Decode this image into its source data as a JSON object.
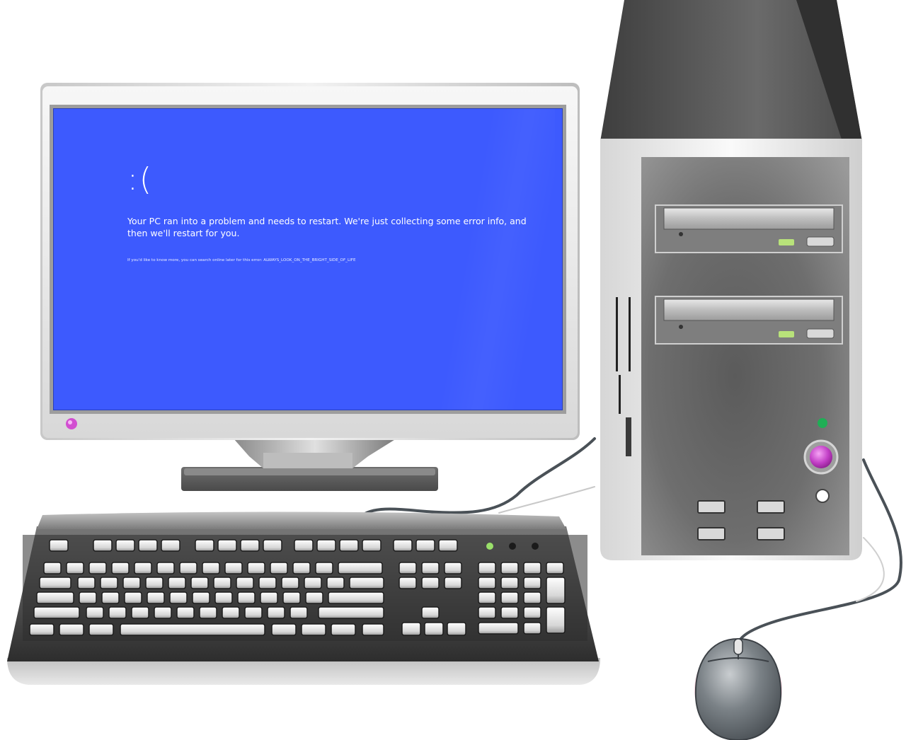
{
  "screen": {
    "sad_face": ":(",
    "message": "Your PC ran into a problem and needs to restart. We're just collecting some error info, and then we'll restart for you.",
    "stop_code_line": "If you'd like to know more, you can search online later for this error: ALWAYS_LOOK_ON_THE_BRIGHT_SIDE_OF_LIFE",
    "background_color": "#3d5afe",
    "text_color": "#ffffff"
  },
  "monitor": {
    "power_led_color": "#d24fd1"
  },
  "tower": {
    "power_button_color": "#c23fc6",
    "status_led_color": "#1fae55",
    "drive_led_color": "#b8e27a"
  },
  "icons": {
    "monitor": "monitor-icon",
    "tower": "computer-tower-icon",
    "keyboard": "keyboard-icon",
    "mouse": "mouse-icon"
  }
}
